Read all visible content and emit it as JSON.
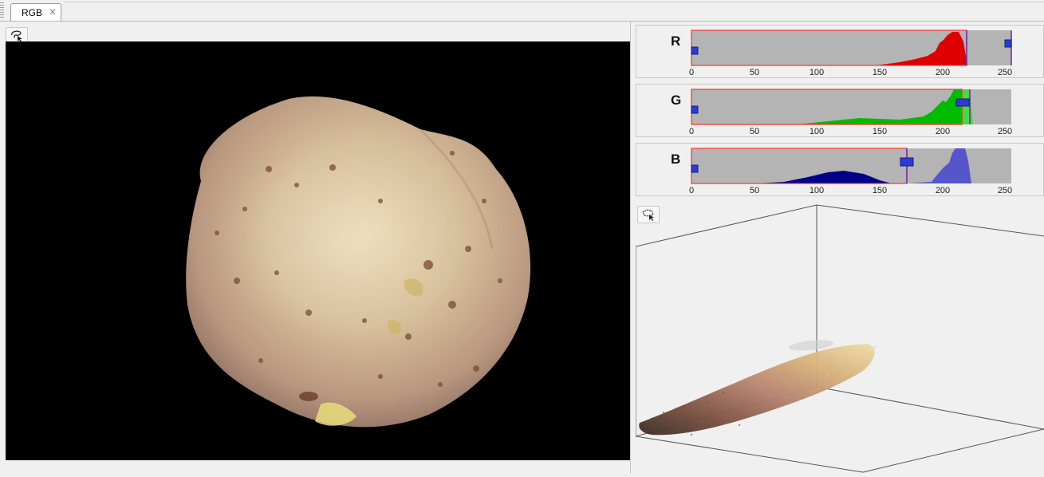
{
  "tabs": [
    {
      "label": "RGB",
      "close_glyph": "✕"
    }
  ],
  "image": {
    "alt": ""
  },
  "histograms": [
    {
      "channel": "R",
      "fill": "#dd0000",
      "band_fill": "#dd0000",
      "ticks": [
        "0",
        "50",
        "100",
        "150",
        "200",
        "250"
      ]
    },
    {
      "channel": "G",
      "fill": "#00bb00",
      "band_fill": "#33dd33",
      "ticks": [
        "0",
        "50",
        "100",
        "150",
        "200",
        "250"
      ]
    },
    {
      "channel": "B",
      "fill": "#00008b",
      "band_fill": "#5555cc",
      "ticks": [
        "0",
        "50",
        "100",
        "150",
        "200",
        "250"
      ]
    }
  ],
  "colors": {
    "panel": "#f0f0f0",
    "hist_bg": "#b4b4b4",
    "frame_border": "#ff3030",
    "handle": "#2d3bd6"
  },
  "icons": {
    "left_tool": "lasso-select-icon",
    "cloud_tool": "lasso-select-icon"
  }
}
